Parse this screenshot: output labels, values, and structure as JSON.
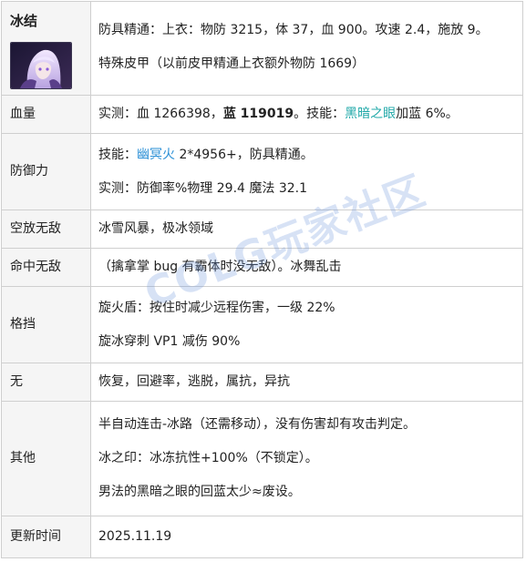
{
  "header": {
    "name": "冰结",
    "line1": "防具精通：上衣：物防 3215，体 37，血 900。攻速 2.4，施放 9。",
    "line2": "特殊皮甲（以前皮甲精通上衣额外物防 1669）"
  },
  "rows": {
    "hp": {
      "label": "血量",
      "prefix": "实测：血 1266398，",
      "blue_bold": "蓝 119019",
      "mid": "。技能：",
      "link": "黑暗之眼",
      "suffix": "加蓝 6%。"
    },
    "defense": {
      "label": "防御力",
      "l1_prefix": "技能：",
      "l1_link": "幽冥火",
      "l1_suffix": " 2*4956+，防具精通。",
      "l2": "实测：防御率%物理 29.4 魔法 32.1"
    },
    "air_invincible": {
      "label": "空放无敌",
      "text": "冰雪风暴，极冰领域"
    },
    "hit_invincible": {
      "label": "命中无敌",
      "text": "（擒拿掌 bug 有霸体时没无敌）。冰舞乱击"
    },
    "block": {
      "label": "格挡",
      "l1": "旋火盾：按住时减少远程伤害，一级 22%",
      "l2": "旋冰穿刺 VP1 减伤 90%"
    },
    "none": {
      "label": "无",
      "text": "恢复，回避率，逃脱，属抗，异抗"
    },
    "other": {
      "label": "其他",
      "l1": "半自动连击-冰路（还需移动），没有伤害却有攻击判定。",
      "l2": "冰之印：冰冻抗性+100%（不锁定）。",
      "l3": "男法的黑暗之眼的回蓝太少≈废设。"
    },
    "updated": {
      "label": "更新时间",
      "text": "2025.11.19"
    }
  },
  "watermark": "COLG玩家社区",
  "colors": {
    "link_teal": "#1fa8a8",
    "link_blue": "#2a8fd6",
    "label_bg": "#f5f5f5",
    "border": "#cfcfcf"
  }
}
